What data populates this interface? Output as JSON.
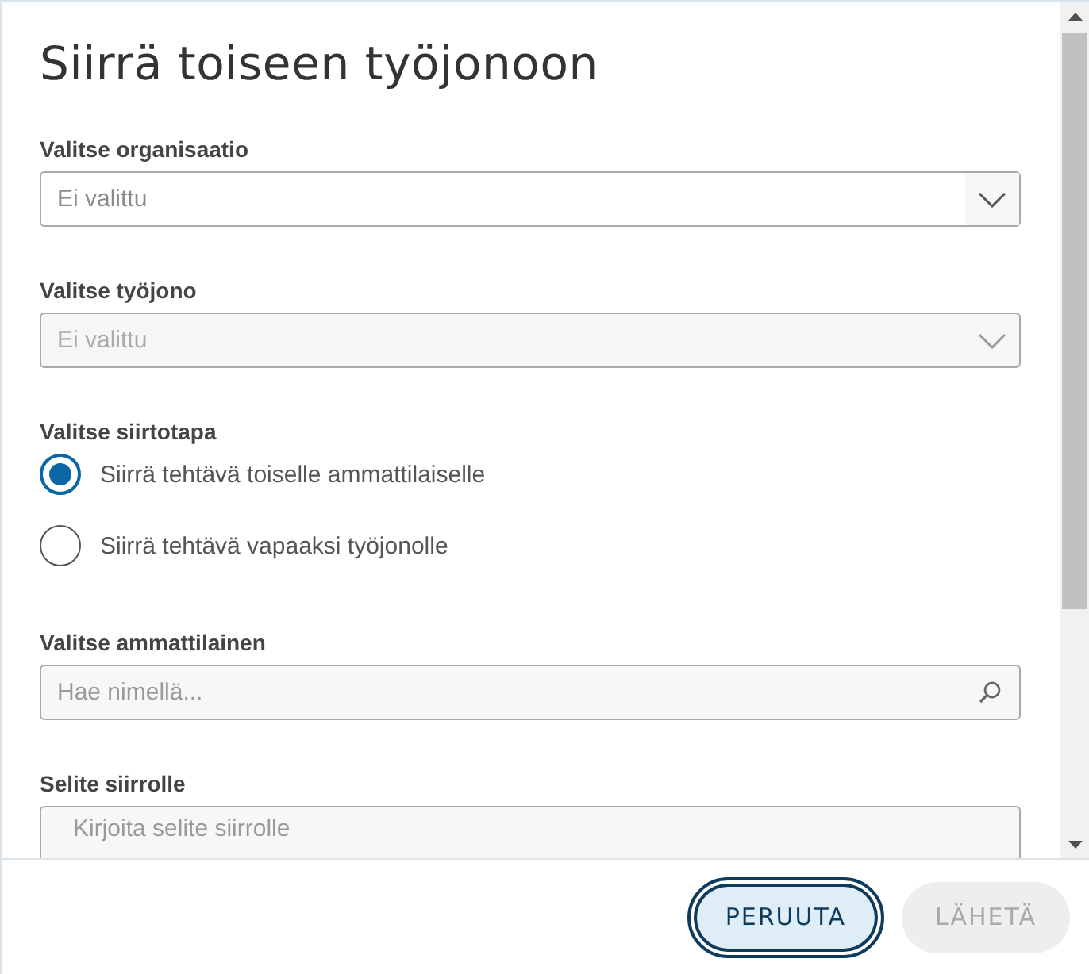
{
  "dialog": {
    "title": "Siirrä toiseen työjonoon"
  },
  "fields": [
    {
      "kind": "select",
      "label": "Valitse organisaatio",
      "placeholder": "Ei valittu",
      "disabled": false
    },
    {
      "kind": "select",
      "label": "Valitse työjono",
      "placeholder": "Ei valittu",
      "disabled": true
    },
    {
      "kind": "radio",
      "label": "Valitse siirtotapa",
      "options": [
        {
          "label": "Siirrä tehtävä toiselle ammattilaiselle",
          "selected": true
        },
        {
          "label": "Siirrä tehtävä vapaaksi työjonolle",
          "selected": false
        }
      ]
    },
    {
      "kind": "search",
      "label": "Valitse ammattilainen",
      "placeholder": "Hae nimellä..."
    },
    {
      "kind": "textarea",
      "label": "Selite siirrolle",
      "placeholder": "Kirjoita selite siirrolle"
    }
  ],
  "buttons": [
    {
      "label": "PERUUTA",
      "focused": true,
      "disabled": false
    },
    {
      "label": "LÄHETÄ",
      "focused": false,
      "disabled": true
    }
  ]
}
